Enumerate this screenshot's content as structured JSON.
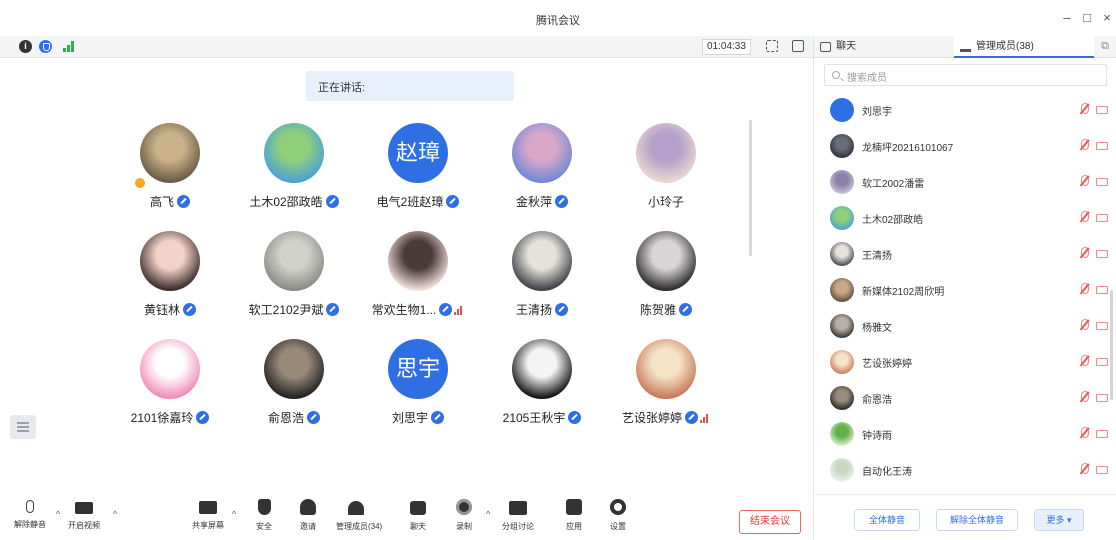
{
  "window": {
    "title": "腾讯会议"
  },
  "status": {
    "timer": "01:04:33"
  },
  "speaking": {
    "label": "正在讲话:"
  },
  "participants": [
    {
      "name": "高飞",
      "avatar": "photo",
      "colors": [
        "#6b5a44",
        "#c9b28a"
      ],
      "host": true
    },
    {
      "name": "土木02邵政皓",
      "avatar": "photo",
      "colors": [
        "#4aa0d8",
        "#8fcf7a"
      ]
    },
    {
      "name": "电气2班赵璋",
      "avatar": "text",
      "avatar_text": "赵璋"
    },
    {
      "name": "金秋萍",
      "avatar": "photo",
      "colors": [
        "#6f88d8",
        "#d9a7c8"
      ]
    },
    {
      "name": "小玲子",
      "avatar": "photo",
      "colors": [
        "#e9d9d0",
        "#b4a0c8"
      ],
      "no_badge": true
    },
    {
      "name": "黄钰林",
      "avatar": "photo",
      "colors": [
        "#3a2a28",
        "#f1d2c7"
      ]
    },
    {
      "name": "软工2102尹斌",
      "avatar": "photo",
      "colors": [
        "#8a8a86",
        "#d2d2cc"
      ]
    },
    {
      "name": "常欢生物1...",
      "avatar": "photo",
      "colors": [
        "#f3e1dc",
        "#4a3a3a"
      ],
      "vol": true
    },
    {
      "name": "王清扬",
      "avatar": "photo",
      "colors": [
        "#3d3f46",
        "#e5e2dc"
      ]
    },
    {
      "name": "陈贺雅",
      "avatar": "photo",
      "colors": [
        "#2b2b2b",
        "#d9d4d6"
      ]
    },
    {
      "name": "2101徐嘉玲",
      "avatar": "photo",
      "colors": [
        "#f08ab6",
        "#ffffff"
      ]
    },
    {
      "name": "俞恩浩",
      "avatar": "photo",
      "colors": [
        "#222222",
        "#9a8a7a"
      ]
    },
    {
      "name": "刘思宇",
      "avatar": "text",
      "avatar_text": "思宇"
    },
    {
      "name": "2105王秋宇",
      "avatar": "photo",
      "colors": [
        "#111111",
        "#f4f4f4"
      ]
    },
    {
      "name": "艺设张婷婷",
      "avatar": "photo",
      "colors": [
        "#c9775a",
        "#f4e3c6"
      ],
      "vol": true
    }
  ],
  "toolbar": {
    "items": [
      {
        "label": "解除静音",
        "icon": "mic-muted-icon"
      },
      {
        "label": "开启视频",
        "icon": "camera-off-icon"
      },
      {
        "label": "共享屏幕",
        "icon": "share-screen-icon"
      },
      {
        "label": "安全",
        "icon": "security-icon"
      },
      {
        "label": "邀请",
        "icon": "invite-icon"
      },
      {
        "label": "管理成员(34)",
        "icon": "members-icon"
      },
      {
        "label": "聊天",
        "icon": "chat-icon"
      },
      {
        "label": "录制",
        "icon": "record-icon"
      },
      {
        "label": "分组讨论",
        "icon": "breakout-icon"
      },
      {
        "label": "应用",
        "icon": "apps-icon"
      },
      {
        "label": "设置",
        "icon": "settings-icon"
      }
    ],
    "end_label": "结束会议"
  },
  "panel": {
    "tabs": [
      {
        "label": "聊天"
      },
      {
        "label": "管理成员(38)"
      }
    ],
    "search_placeholder": "搜索成员",
    "members": [
      {
        "name": "刘思宇",
        "colors": [
          "#2f6fe4",
          "#2f6fe4"
        ]
      },
      {
        "name": "龙楠坪20216101067",
        "colors": [
          "#2b2d3a",
          "#6a6d7a"
        ]
      },
      {
        "name": "软工2002潘雷",
        "colors": [
          "#cfc6e0",
          "#8a7fa8"
        ]
      },
      {
        "name": "土木02邵政皓",
        "colors": [
          "#4aa0d8",
          "#8fcf7a"
        ]
      },
      {
        "name": "王清扬",
        "colors": [
          "#3d3f46",
          "#e5e2dc"
        ]
      },
      {
        "name": "新媒体2102周欣明",
        "colors": [
          "#5a4638",
          "#c9a98a"
        ]
      },
      {
        "name": "杨雅文",
        "colors": [
          "#2e2e2e",
          "#b8b0a8"
        ]
      },
      {
        "name": "艺设张婷婷",
        "colors": [
          "#c9775a",
          "#f4e3c6"
        ]
      },
      {
        "name": "俞恩浩",
        "colors": [
          "#222222",
          "#9a8a7a"
        ]
      },
      {
        "name": "钟诗雨",
        "colors": [
          "#e4f3da",
          "#62b04a"
        ]
      },
      {
        "name": "自动化王涛",
        "colors": [
          "#f1f1f1",
          "#c8d8c0"
        ]
      }
    ],
    "footer": {
      "mute_all": "全体静音",
      "unmute_all": "解除全体静音",
      "more": "更多 ▾"
    }
  },
  "colors": {
    "accent": "#2f6fe4",
    "danger": "#e33333",
    "signal": "#2fae4e"
  }
}
